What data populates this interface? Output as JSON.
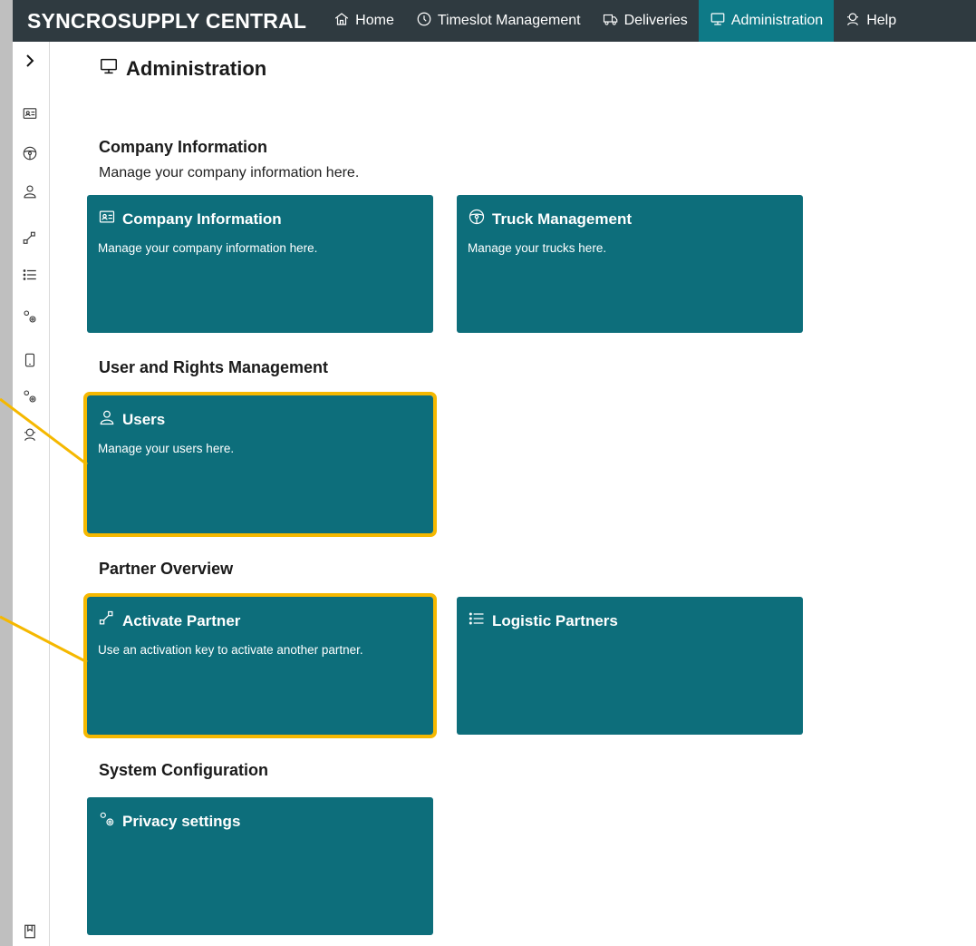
{
  "app": {
    "brand": "SYNCROSUPPLY CENTRAL"
  },
  "nav": {
    "items": [
      {
        "label": "Home",
        "icon": "home-icon"
      },
      {
        "label": "Timeslot Management",
        "icon": "clock-icon"
      },
      {
        "label": "Deliveries",
        "icon": "truck-icon"
      },
      {
        "label": "Administration",
        "icon": "monitor-icon",
        "active": true
      },
      {
        "label": "Help",
        "icon": "support-icon"
      }
    ]
  },
  "sidebar": {
    "expand_icon": "chevron-right-icon",
    "items": [
      "id-card-icon",
      "steering-wheel-icon",
      "user-icon",
      "activate-partner-icon",
      "list-icon",
      "settings-gears-icon",
      "mobile-icon",
      "settings-gears-icon",
      "support-user-icon"
    ],
    "bottom_icon": "bookmark-icon"
  },
  "page": {
    "title": "Administration"
  },
  "sections": [
    {
      "title": "Company Information",
      "description": "Manage your company information here.",
      "tiles": [
        {
          "title": "Company Information",
          "description": "Manage your company information here.",
          "icon": "id-card-icon"
        },
        {
          "title": "Truck Management",
          "description": "Manage your trucks here.",
          "icon": "steering-wheel-icon"
        }
      ]
    },
    {
      "title": "User and Rights Management",
      "tiles": [
        {
          "title": "Users",
          "description": "Manage your users here.",
          "icon": "user-icon",
          "highlighted": true
        }
      ]
    },
    {
      "title": "Partner Overview",
      "tiles": [
        {
          "title": "Activate Partner",
          "description": "Use an activation key to activate another partner.",
          "icon": "activate-partner-icon",
          "highlighted": true
        },
        {
          "title": "Logistic Partners",
          "description": "",
          "icon": "list-icon"
        }
      ]
    },
    {
      "title": "System Configuration",
      "tiles": [
        {
          "title": "Privacy settings",
          "description": "",
          "icon": "settings-gears-icon"
        }
      ]
    }
  ],
  "colors": {
    "topbar": "#2f3a40",
    "nav_active": "#0e7a87",
    "tile": "#0d6e7b",
    "highlight": "#f5b800"
  }
}
